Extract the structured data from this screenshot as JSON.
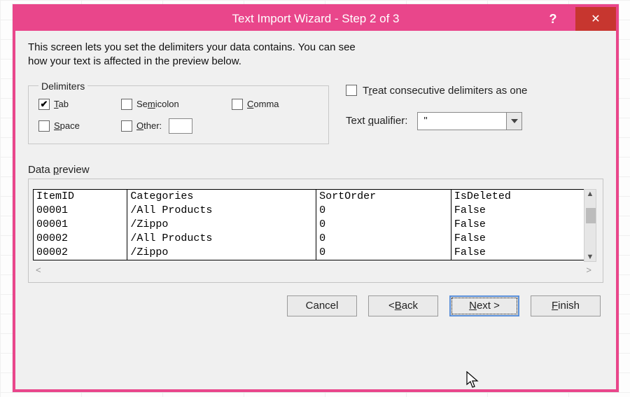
{
  "title": "Text Import Wizard - Step 2 of 3",
  "intro_line1": "This screen lets you set the delimiters your data contains.  You can see",
  "intro_line2": "how your text is affected in the preview below.",
  "delimiters": {
    "legend": "Delimiters",
    "tab": {
      "label_pre": "",
      "mn": "T",
      "label_post": "ab",
      "checked": true
    },
    "semicolon": {
      "label_pre": "Se",
      "mn": "m",
      "label_post": "icolon",
      "checked": false
    },
    "comma": {
      "label_pre": "",
      "mn": "C",
      "label_post": "omma",
      "checked": false
    },
    "space": {
      "label_pre": "",
      "mn": "S",
      "label_post": "pace",
      "checked": false
    },
    "other": {
      "label_pre": "",
      "mn": "O",
      "label_post": "ther:",
      "checked": false,
      "value": ""
    }
  },
  "treat": {
    "label_pre": "T",
    "mn": "r",
    "label_post": "eat consecutive delimiters as one",
    "checked": false
  },
  "qualifier": {
    "label_pre": "Text ",
    "mn": "q",
    "label_post": "ualifier:",
    "value": "\""
  },
  "preview_label_pre": "Data ",
  "preview_label_mn": "p",
  "preview_label_post": "review",
  "preview": {
    "headers": [
      "ItemID",
      "Categories",
      "SortOrder",
      "IsDeleted"
    ],
    "rows": [
      [
        "00001",
        "/All Products",
        "0",
        "False"
      ],
      [
        "00001",
        "/Zippo",
        "0",
        "False"
      ],
      [
        "00002",
        "/All Products",
        "0",
        "False"
      ],
      [
        "00002",
        "/Zippo",
        "0",
        "False"
      ]
    ]
  },
  "buttons": {
    "cancel": "Cancel",
    "back_pre": "< ",
    "back_mn": "B",
    "back_post": "ack",
    "next_pre": "",
    "next_mn": "N",
    "next_post": "ext >",
    "finish_pre": "",
    "finish_mn": "F",
    "finish_post": "inish"
  }
}
